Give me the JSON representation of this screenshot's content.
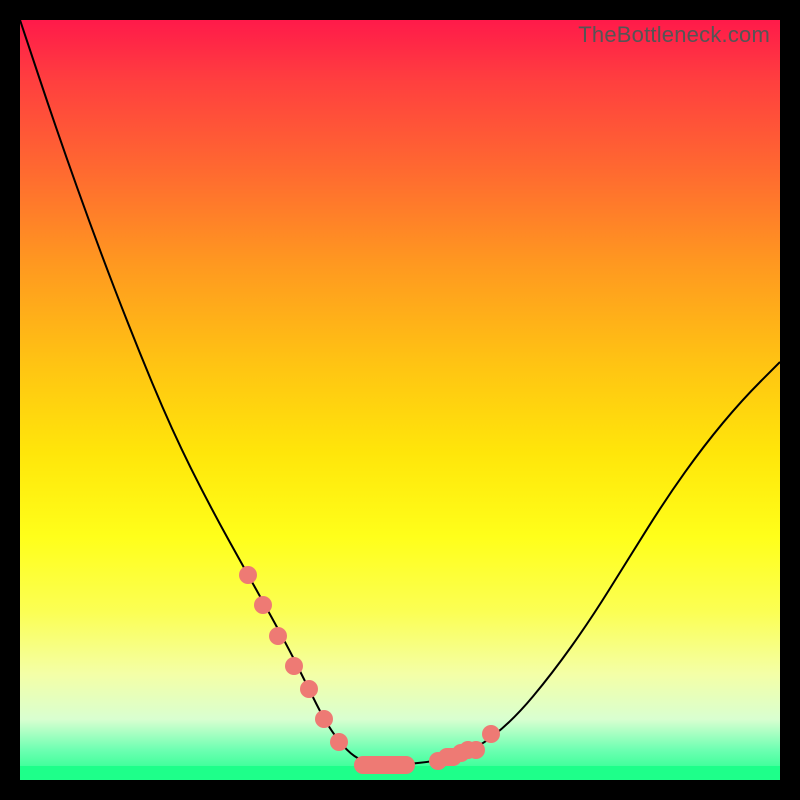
{
  "attribution": "TheBottleneck.com",
  "colors": {
    "frame": "#000000",
    "curve": "#000000",
    "marker": "#ee7a74",
    "gradient_top": "#ff1a4a",
    "gradient_bottom": "#1eff8a"
  },
  "chart_data": {
    "type": "line",
    "title": "",
    "xlabel": "",
    "ylabel": "",
    "xlim": [
      0,
      100
    ],
    "ylim": [
      0,
      100
    ],
    "grid": false,
    "legend": false,
    "series": [
      {
        "name": "bottleneck-curve",
        "x": [
          0,
          5,
          10,
          15,
          20,
          25,
          30,
          35,
          38,
          40,
          42,
          44,
          46,
          48,
          50,
          55,
          60,
          65,
          70,
          75,
          80,
          85,
          90,
          95,
          100
        ],
        "y": [
          100,
          85,
          71,
          58,
          46,
          36,
          27,
          18,
          12,
          8,
          5,
          3,
          2.2,
          2,
          2,
          2.5,
          4,
          8,
          14,
          21,
          29,
          37,
          44,
          50,
          55
        ]
      }
    ],
    "markers": {
      "name": "highlighted-points",
      "color": "#ee7a74",
      "x": [
        30,
        32,
        34,
        36,
        38,
        40,
        42,
        55,
        57,
        58,
        59,
        60,
        62
      ],
      "y": [
        27,
        23,
        19,
        15,
        12,
        8,
        5,
        2.5,
        3,
        3.5,
        4,
        4,
        6
      ]
    },
    "pills": [
      {
        "x_range": [
          44,
          52
        ],
        "y": 2,
        "color": "#ee7a74"
      },
      {
        "x_range": [
          55,
          58
        ],
        "y": 3,
        "color": "#ee7a74"
      }
    ],
    "background_gradient": {
      "direction": "top-to-bottom",
      "stops": [
        {
          "pct": 0,
          "color": "#ff1a4a"
        },
        {
          "pct": 20,
          "color": "#ff6a30"
        },
        {
          "pct": 45,
          "color": "#ffc313"
        },
        {
          "pct": 68,
          "color": "#ffff1a"
        },
        {
          "pct": 92,
          "color": "#d9ffd0"
        },
        {
          "pct": 100,
          "color": "#1eff8a"
        }
      ]
    }
  }
}
